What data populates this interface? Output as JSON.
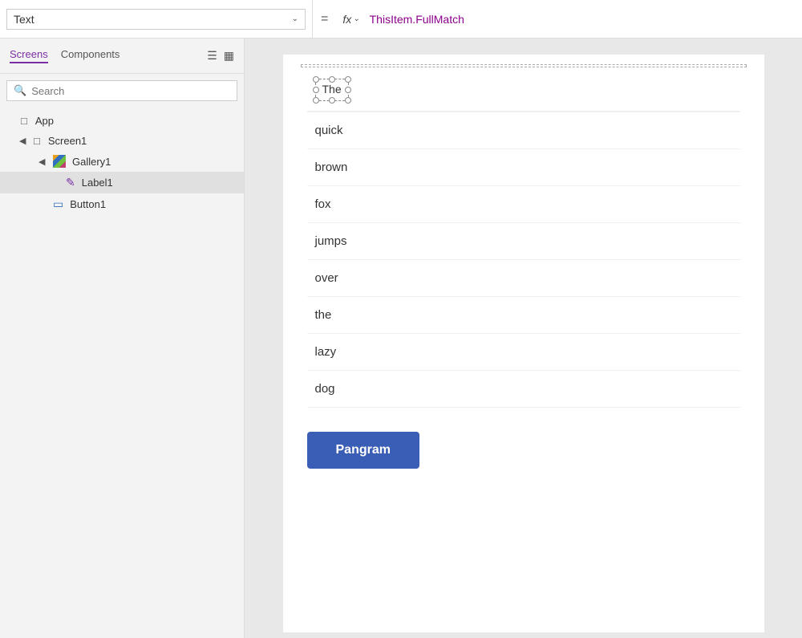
{
  "topbar": {
    "property_label": "Text",
    "equals": "=",
    "fx_label": "fx",
    "formula": "ThisItem.FullMatch"
  },
  "sidebar": {
    "tab_screens": "Screens",
    "tab_components": "Components",
    "search_placeholder": "Search",
    "tree": [
      {
        "id": "app",
        "label": "App",
        "indent": 1,
        "icon": "app",
        "expanded": true,
        "arrow": ""
      },
      {
        "id": "screen1",
        "label": "Screen1",
        "indent": 2,
        "icon": "screen",
        "expanded": true,
        "arrow": "◀"
      },
      {
        "id": "gallery1",
        "label": "Gallery1",
        "indent": 3,
        "icon": "gallery",
        "expanded": true,
        "arrow": "◀"
      },
      {
        "id": "label1",
        "label": "Label1",
        "indent": 4,
        "icon": "label",
        "selected": true,
        "arrow": ""
      },
      {
        "id": "button1",
        "label": "Button1",
        "indent": 3,
        "icon": "button",
        "arrow": ""
      }
    ]
  },
  "canvas": {
    "label_first_text": "The",
    "gallery_items": [
      "quick",
      "brown",
      "fox",
      "jumps",
      "over",
      "the",
      "lazy",
      "dog"
    ],
    "button_label": "Pangram"
  }
}
